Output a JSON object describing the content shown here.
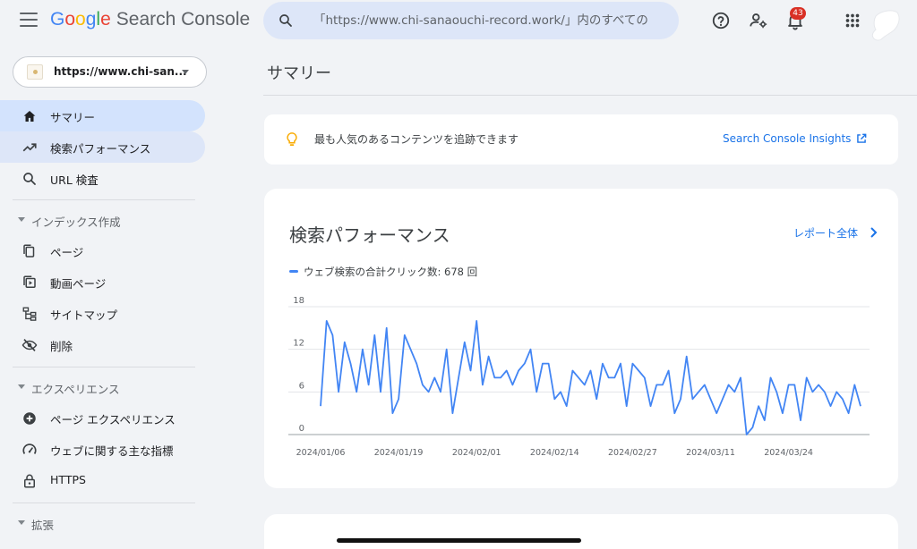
{
  "header": {
    "logo_google": [
      "G",
      "o",
      "o",
      "g",
      "l",
      "e"
    ],
    "logo_product": "Search Console",
    "search_placeholder": "「https://www.chi-sanaouchi-record.work/」内のすべての",
    "notification_count": "43",
    "icons": [
      "menu-icon",
      "search-icon",
      "help-icon",
      "manage-users-icon",
      "notifications-icon",
      "apps-icon"
    ]
  },
  "sidebar": {
    "property_label": "https://www.chi-san...",
    "items": [
      {
        "label": "サマリー",
        "icon": "home-icon"
      },
      {
        "label": "検索パフォーマンス",
        "icon": "trending-icon"
      },
      {
        "label": "URL 検査",
        "icon": "search-icon"
      }
    ],
    "sections": [
      {
        "title": "インデックス作成",
        "items": [
          {
            "label": "ページ",
            "icon": "pages-icon"
          },
          {
            "label": "動画ページ",
            "icon": "video-icon"
          },
          {
            "label": "サイトマップ",
            "icon": "sitemap-icon"
          },
          {
            "label": "削除",
            "icon": "visibility-off-icon"
          }
        ]
      },
      {
        "title": "エクスペリエンス",
        "items": [
          {
            "label": "ページ エクスペリエンス",
            "icon": "add-circle-icon"
          },
          {
            "label": "ウェブに関する主な指標",
            "icon": "speed-icon"
          },
          {
            "label": "HTTPS",
            "icon": "lock-icon"
          }
        ]
      },
      {
        "title": "拡張",
        "items": []
      }
    ]
  },
  "main": {
    "page_title": "サマリー",
    "insight": {
      "text": "最も人気のあるコンテンツを追跡できます",
      "link": "Search Console Insights"
    },
    "performance": {
      "title": "検索パフォーマンス",
      "report_link": "レポート全体",
      "legend": "ウェブ検索の合計クリック数: 678 回"
    }
  },
  "colors": {
    "accent": "#1a73e8",
    "series": "#4285f4",
    "active_nav": "#d3e3fd",
    "badge": "#d93025"
  },
  "chart_data": {
    "type": "line",
    "title": "",
    "xlabel": "",
    "ylabel": "",
    "ylim": [
      0,
      18
    ],
    "yticks": [
      0,
      6,
      12,
      18
    ],
    "x_tick_labels": [
      "2024/01/06",
      "2024/01/19",
      "2024/02/01",
      "2024/02/14",
      "2024/02/27",
      "2024/03/11",
      "2024/03/24"
    ],
    "x_start": "2024/01/06",
    "x_end": "2024/04/02",
    "grid": true,
    "series": [
      {
        "name": "ウェブ検索の合計クリック数",
        "values": [
          4,
          16,
          14,
          6,
          13,
          10,
          6,
          12,
          7,
          14,
          6,
          15,
          3,
          5,
          14,
          12,
          10,
          7,
          6,
          8,
          6,
          12,
          3,
          8,
          13,
          9,
          16,
          7,
          11,
          8,
          8,
          9,
          7,
          9,
          10,
          12,
          6,
          10,
          10,
          5,
          6,
          4,
          9,
          8,
          7,
          9,
          5,
          10,
          8,
          8,
          10,
          4,
          10,
          9,
          8,
          4,
          7,
          7,
          9,
          3,
          5,
          11,
          5,
          6,
          7,
          5,
          3,
          5,
          7,
          6,
          8,
          0,
          1,
          4,
          2,
          8,
          6,
          3,
          7,
          7,
          2,
          8,
          6,
          7,
          6,
          4,
          6,
          5,
          3,
          7,
          4
        ]
      }
    ]
  }
}
